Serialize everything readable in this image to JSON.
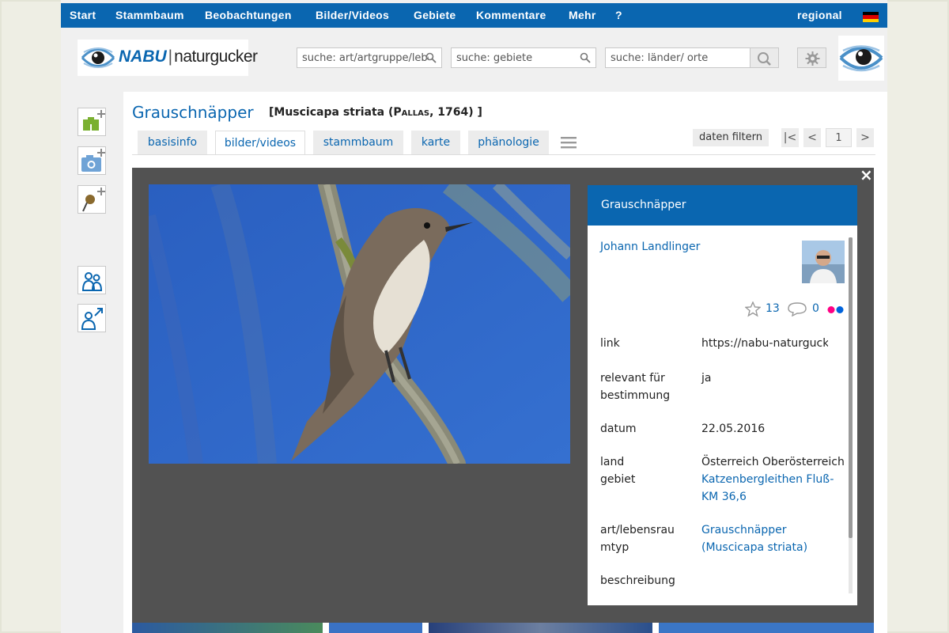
{
  "nav": {
    "items": [
      "Start",
      "Stammbaum",
      "Beobachtungen",
      "Bilder/Videos",
      "Gebiete",
      "Kommentare",
      "Mehr",
      "?"
    ],
    "regional": "regional"
  },
  "logo": {
    "nabu": "NABU",
    "sep": "|",
    "name": "naturgucker"
  },
  "search": {
    "species_placeholder": "suche: art/artgruppe/lebensraum",
    "areas_placeholder": "suche: gebiete",
    "countries_placeholder": "suche: länder/ orte"
  },
  "species": {
    "name": "Grauschnäpper",
    "scientific_open": "[Muscicapa striata (",
    "author": "Pallas",
    "scientific_close": ", 1764) ]"
  },
  "tabs": [
    "basisinfo",
    "bilder/videos",
    "stammbaum",
    "karte",
    "phänologie"
  ],
  "filter_label": "daten filtern",
  "pager": {
    "first": "|<",
    "prev": "<",
    "page": "1",
    "next": ">"
  },
  "overlay": {
    "close": "×"
  },
  "info": {
    "title": "Grauschnäpper",
    "author": "Johann Landlinger",
    "stars": "13",
    "comments": "0",
    "rows": {
      "link_label": "link",
      "link_value": "https://nabu-naturgucker.de",
      "relevant_label_1": "relevant für",
      "relevant_label_2": "bestimmung",
      "relevant_value": "ja",
      "date_label": "datum",
      "date_value": "22.05.2016",
      "land_label": "land",
      "area_label": "gebiet",
      "land_value": "Österreich Oberösterreich",
      "area_value_1": "Katzenbergleithen Fluß-",
      "area_value_2": "KM 36,6",
      "type_label_1": "art/lebensrau",
      "type_label_2": "mtyp",
      "type_value_1": "Grauschnäpper",
      "type_value_2": "(Muscicapa striata)",
      "desc_label": "beschreibung"
    }
  },
  "colors": {
    "brand_blue": "#0a66b0",
    "overlay_gray": "#525252",
    "flickr_pink": "#ff0084",
    "flickr_blue": "#0063dc"
  }
}
